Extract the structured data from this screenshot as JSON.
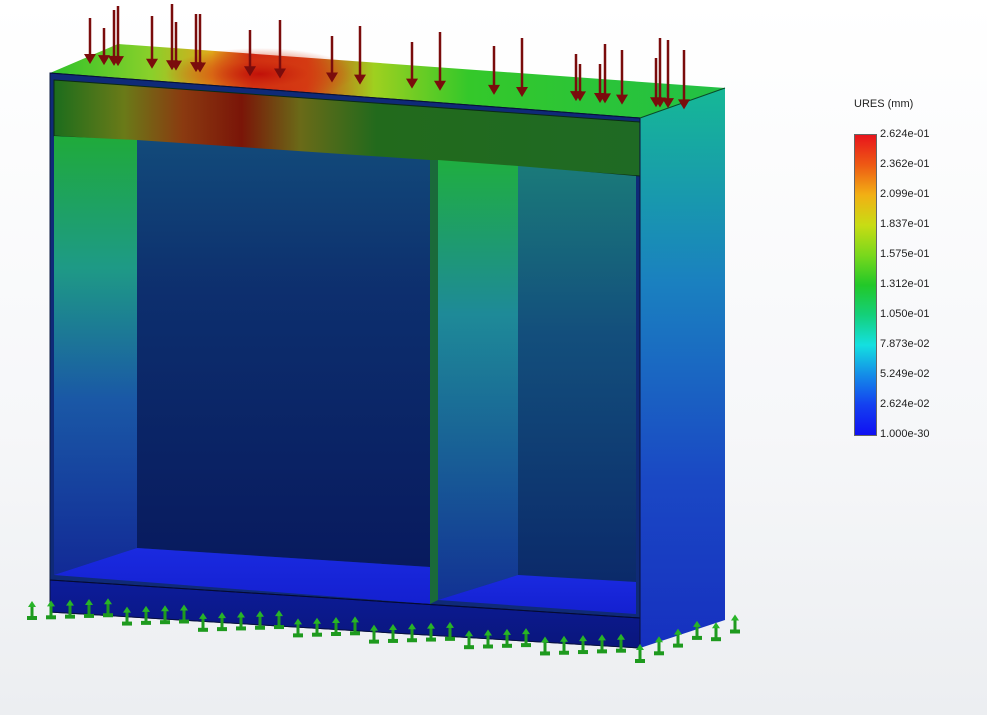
{
  "legend": {
    "title": "URES (mm)",
    "ticks": [
      "2.624e-01",
      "2.362e-01",
      "2.099e-01",
      "1.837e-01",
      "1.575e-01",
      "1.312e-01",
      "1.050e-01",
      "7.873e-02",
      "5.249e-02",
      "2.624e-02",
      "1.000e-30"
    ],
    "gradient_colors": [
      "#e8141c",
      "#ee5a14",
      "#f2b014",
      "#c8dc14",
      "#7ad81c",
      "#22c828",
      "#14d07a",
      "#14e0e0",
      "#148ce8",
      "#1440f0",
      "#1010f2"
    ]
  },
  "model": {
    "load_icon": "red-down-arrow",
    "fixture_icon": "green-fixture-pin"
  }
}
